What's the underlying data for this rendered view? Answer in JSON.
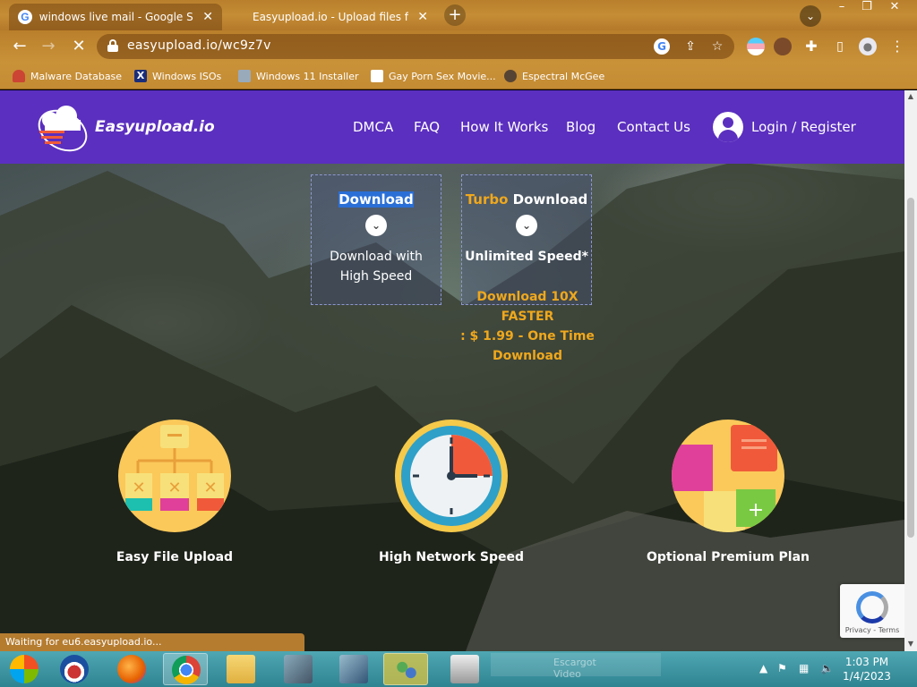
{
  "browser": {
    "tabs": [
      {
        "title": "windows live mail - Google Search",
        "active": true
      },
      {
        "title": "Easyupload.io - Upload files for fr",
        "active": false
      }
    ],
    "new_tab": "+",
    "url": "easyupload.io/wc9z7v",
    "window_controls": [
      "–",
      "❐",
      "✕"
    ],
    "bookmarks": [
      {
        "label": "Malware Database",
        "icon": "mushroom-icon"
      },
      {
        "label": "Windows ISOs",
        "icon": "x-logo-icon"
      },
      {
        "label": "Windows 11 Installer",
        "icon": "image-icon"
      },
      {
        "label": "Gay Porn Sex Movie...",
        "icon": "site-icon"
      },
      {
        "label": "Espectral McGee",
        "icon": "avatar-icon"
      }
    ]
  },
  "site": {
    "brand": "Easyupload.io",
    "nav": [
      "DMCA",
      "FAQ",
      "How It Works",
      "Blog",
      "Contact Us"
    ],
    "login": "Login / Register",
    "colors": {
      "header": "#5b2fbf",
      "accent": "#f0a81c"
    },
    "download": {
      "title": "Download",
      "desc1": "Download with",
      "desc2": "High Speed"
    },
    "turbo": {
      "turbo_word": "Turbo",
      "title_rest": "Download",
      "desc": "Unlimited Speed*"
    },
    "promo": [
      "Download 10X FASTER",
      ": $ 1.99 - One Time",
      "Download"
    ],
    "features": [
      {
        "label": "Easy File Upload",
        "icon": "file-tree-icon"
      },
      {
        "label": "High Network Speed",
        "icon": "clock-icon"
      },
      {
        "label": "Optional Premium Plan",
        "icon": "puzzle-icon"
      }
    ],
    "recaptcha": "Privacy - Terms"
  },
  "status_bar": "Waiting for eu6.easyupload.io...",
  "taskbar": {
    "ghost_text": "Escargot Video",
    "time": "1:03 PM",
    "date": "1/4/2023"
  }
}
